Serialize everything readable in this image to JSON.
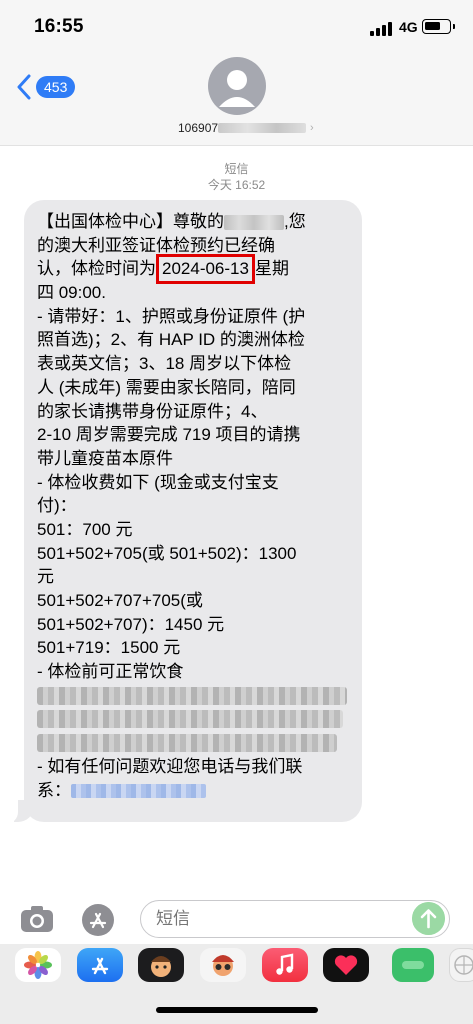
{
  "status_bar": {
    "time": "16:55",
    "network": "4G",
    "battery_level": 0.7
  },
  "header": {
    "back_count": "453",
    "contact_number": "106907"
  },
  "thread": {
    "channel": "短信",
    "timestamp": "今天 16:52"
  },
  "message": {
    "line1_a": "【出国体检中心】尊敬的",
    "line1_b": ",您",
    "line2": "的澳大利亚签证体检预约已经确",
    "line3_a": "认，体检时间为",
    "date": "2024-06-13",
    "line3_b": "星期",
    "line4": "四 09:00.",
    "line5": "- 请带好：1、护照或身份证原件 (护",
    "line6": "照首选)；2、有 HAP ID 的澳洲体检",
    "line7": "表或英文信；3、18 周岁以下体检",
    "line8": "人 (未成年) 需要由家长陪同，陪同",
    "line9": "的家长请携带身份证原件；4、",
    "line10": "2-10 周岁需要完成 719 项目的请携",
    "line11": "带儿童疫苗本原件",
    "line12": "- 体检收费如下 (现金或支付宝支",
    "line13": "付)：",
    "line14": "501：700 元",
    "line15": "501+502+705(或 501+502)：1300",
    "line16": "元",
    "line17": "501+502+707+705(或",
    "line18": "501+502+707)：1450 元",
    "line19": "501+719：1500 元",
    "line20": "- 体检前可正常饮食",
    "line21": "- 如有任何问题欢迎您电话与我们联",
    "line22": "系："
  },
  "compose": {
    "placeholder": "短信"
  },
  "dock": {
    "apps": [
      "photos-app-icon",
      "app-store-app-icon",
      "memoji-app-icon",
      "memoji-stickers-app-icon",
      "music-app-icon",
      "digital-touch-app-icon",
      "extension-app-icon",
      "more-app-icon"
    ]
  },
  "colors": {
    "accent": "#2f7cf6",
    "bubble": "#e9e9eb",
    "highlight": "#e00000",
    "send": "#9bd9a4"
  }
}
